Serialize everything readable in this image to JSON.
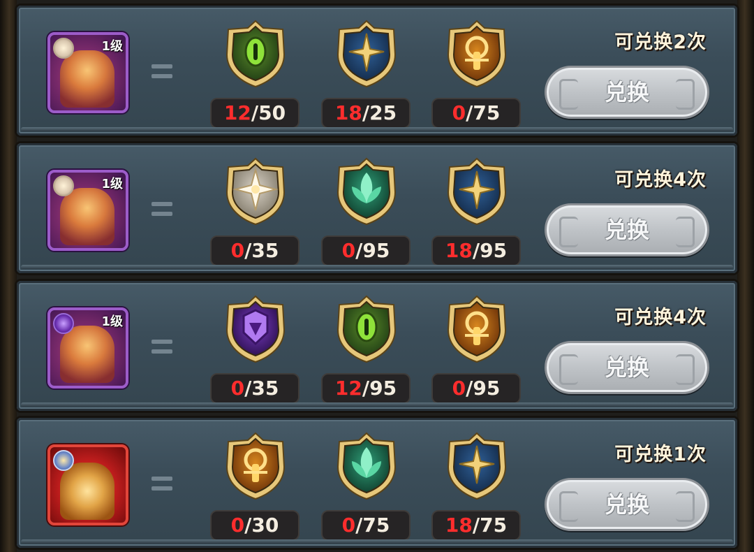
{
  "rows": [
    {
      "portrait_type": "hero",
      "portrait_frame": "purple",
      "level": "1级",
      "badge": "light",
      "items": [
        {
          "icon": "eye-emblem-icon",
          "have": "12",
          "need": "/50"
        },
        {
          "icon": "star-emblem-icon",
          "have": "18",
          "need": "/25"
        },
        {
          "icon": "sun-emblem-icon",
          "have": "0",
          "need": "/75"
        }
      ],
      "times_label": "可兑换2次",
      "button_label": "兑换"
    },
    {
      "portrait_type": "hero",
      "portrait_frame": "purple",
      "level": "1级",
      "badge": "light",
      "items": [
        {
          "icon": "radiant-emblem-icon",
          "have": "0",
          "need": "/35"
        },
        {
          "icon": "leaf-emblem-icon",
          "have": "0",
          "need": "/95"
        },
        {
          "icon": "star-emblem-icon",
          "have": "18",
          "need": "/95"
        }
      ],
      "times_label": "可兑换4次",
      "button_label": "兑换"
    },
    {
      "portrait_type": "hero",
      "portrait_frame": "purple",
      "level": "1级",
      "badge": "dark",
      "items": [
        {
          "icon": "void-emblem-icon",
          "have": "0",
          "need": "/35"
        },
        {
          "icon": "eye-emblem-icon",
          "have": "12",
          "need": "/95"
        },
        {
          "icon": "sun-emblem-icon",
          "have": "0",
          "need": "/95"
        }
      ],
      "times_label": "可兑换4次",
      "button_label": "兑换"
    },
    {
      "portrait_type": "chest",
      "portrait_frame": "red",
      "level": "",
      "badge": "star",
      "items": [
        {
          "icon": "sun-emblem-icon",
          "have": "0",
          "need": "/30"
        },
        {
          "icon": "leaf-emblem-icon",
          "have": "0",
          "need": "/75"
        },
        {
          "icon": "star-emblem-icon",
          "have": "18",
          "need": "/75"
        }
      ],
      "times_label": "可兑换1次",
      "button_label": "兑换"
    }
  ],
  "colors": {
    "panel": "#3b4d59",
    "insufficient": "#ff2d2d",
    "button_disabled": "#bfc3c7"
  }
}
